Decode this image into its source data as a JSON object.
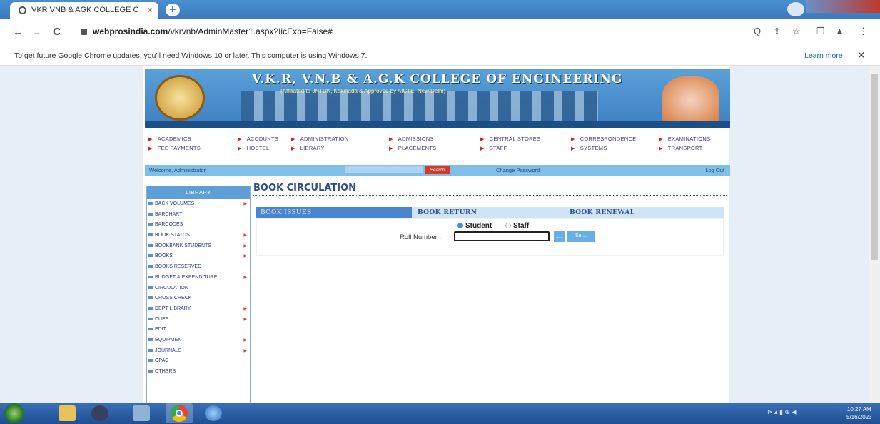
{
  "browser": {
    "tab_title": "VKR VNB & AGK COLLEGE OF E",
    "tab_close": "×",
    "new_tab": "+",
    "url_host": "webprosindia.com",
    "url_path": "/vkrvnb/AdminMaster1.aspx?IicExp=False#",
    "back": "←",
    "forward": "→",
    "reload": "C",
    "toolbar_icons": [
      "Q",
      "⇪",
      "☆",
      "❐",
      "▲",
      "⋮"
    ]
  },
  "infobar": {
    "message": "To get future Google Chrome updates, you'll need Windows 10 or later. This computer is using Windows 7.",
    "learn_more": "Learn more",
    "close": "✕"
  },
  "site": {
    "banner_title": "V.K.R, V.N.B & A.G.K COLLEGE OF ENGINEERING",
    "banner_subtitle": "(Affiliated to JNTUK, Kakinada & Approved by AICTE, New Delhi)",
    "menu": [
      "ACADEMICS",
      "ACCOUNTS",
      "ADMINISTRATION",
      "ADMISSIONS",
      "CENTRAL STORES",
      "CORRESPONDENCE",
      "EXAMINATIONS",
      "FEE PAYMENTS",
      "HOSTEL",
      "LIBRARY",
      "PLACEMENTS",
      "STAFF",
      "SYSTEMS",
      "TRANSPORT"
    ],
    "welcome": "Welcome, Administrator",
    "search_button": "Search",
    "change_password": "Change Password",
    "logout": "Log Out"
  },
  "sidebar": {
    "header": "LIBRARY",
    "items": [
      {
        "label": "BACK VOLUMES",
        "arrow": true
      },
      {
        "label": "BARCHART",
        "arrow": false
      },
      {
        "label": "BARCODES",
        "arrow": false
      },
      {
        "label": "BOOK STATUS",
        "arrow": true
      },
      {
        "label": "BOOKBANK STUDENTS",
        "arrow": true
      },
      {
        "label": "BOOKS",
        "arrow": true
      },
      {
        "label": "BOOKS RESERVED",
        "arrow": false
      },
      {
        "label": "BUDGET & EXPENDITURE",
        "arrow": true
      },
      {
        "label": "CIRCULATION",
        "arrow": false
      },
      {
        "label": "CROSS CHECK",
        "arrow": false
      },
      {
        "label": "DEPT LIBRARY",
        "arrow": true
      },
      {
        "label": "DUES",
        "arrow": true
      },
      {
        "label": "EDIT",
        "arrow": false
      },
      {
        "label": "EQUIPMENT",
        "arrow": true
      },
      {
        "label": "JOURNALS",
        "arrow": true
      },
      {
        "label": "OPAC",
        "arrow": false
      },
      {
        "label": "OTHERS",
        "arrow": false
      }
    ],
    "arrow_glyph": "▶"
  },
  "main": {
    "heading": "BOOK CIRCULATION",
    "tabs": [
      "BOOK ISSUES",
      "BOOK RETURN",
      "BOOK RENEWAL"
    ],
    "radio_student": "Student",
    "radio_staff": "Staff",
    "roll_label": "Roll Number :",
    "roll_value": "",
    "btn_small": "...",
    "btn_select": "Sel..."
  },
  "taskbar": {
    "time": "10:27 AM",
    "date": "5/16/2023"
  }
}
